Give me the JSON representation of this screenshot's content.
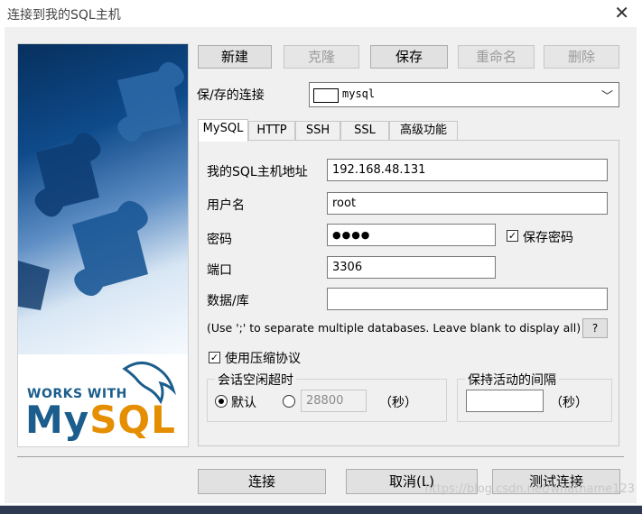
{
  "window": {
    "title": "连接到我的SQL主机",
    "close": "✕"
  },
  "banner": {
    "works_with": "WORKS WITH",
    "logo_my": "My",
    "logo_sql": "SQL"
  },
  "toolbar": {
    "new": "新建",
    "clone": "克隆",
    "save": "保存",
    "rename": "重命名",
    "delete": "删除"
  },
  "saved": {
    "label": "保/存的连接",
    "value": "mysql"
  },
  "tabs": [
    "MySQL",
    "HTTP",
    "SSH",
    "SSL",
    "高级功能"
  ],
  "form": {
    "host_label": "我的SQL主机地址",
    "host": "192.168.48.131",
    "user_label": "用户名",
    "user": "root",
    "password_label": "密码",
    "password": "●●●●",
    "save_password": "保存密码",
    "port_label": "端口",
    "port": "3306",
    "db_label": "数据/库",
    "database": "",
    "hint": "(Use ';' to separate multiple databases. Leave blank to display all)",
    "help": "?",
    "compress": "使用压缩协议"
  },
  "idle": {
    "legend": "会话空闲超时",
    "default": "默认",
    "value": "28800",
    "unit": "（秒）"
  },
  "keepalive": {
    "legend": "保持活动的间隔",
    "value": "",
    "unit": "（秒）"
  },
  "footer": {
    "connect": "连接",
    "cancel": "取消(L)",
    "test": "测试连接"
  },
  "watermark": "https://blog.csdn.net/whatname123",
  "colors": {
    "mysql_blue": "#1b5d8c",
    "mysql_orange": "#e48e00"
  }
}
